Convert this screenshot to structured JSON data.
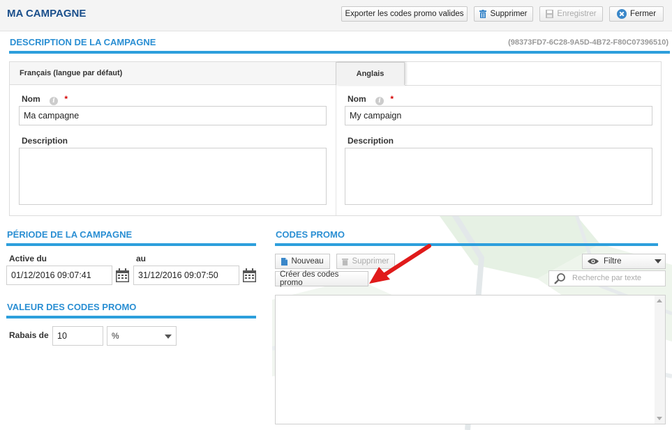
{
  "header": {
    "title": "MA CAMPAGNE",
    "buttons": {
      "export_label": "Exporter les codes promo valides",
      "delete_label": "Supprimer",
      "save_label": "Enregistrer",
      "close_label": "Fermer"
    }
  },
  "description_section": {
    "title": "DESCRIPTION DE LA CAMPAGNE",
    "campaign_id": "(98373FD7-6C28-9A5D-4B72-F80C07396510)",
    "tabs": {
      "fr_label": "Français (langue par défaut)",
      "en_label": "Anglais"
    },
    "fr": {
      "name_label": "Nom",
      "required_mark": "*",
      "name_value": "Ma campagne",
      "description_label": "Description",
      "description_value": ""
    },
    "en": {
      "name_label": "Nom",
      "required_mark": "*",
      "name_value": "My campaign",
      "description_label": "Description",
      "description_value": ""
    }
  },
  "period_section": {
    "title": "PÉRIODE DE LA CAMPAGNE",
    "start_label": "Active du",
    "start_value": "01/12/2016 09:07:41",
    "end_label": "au",
    "end_value": "31/12/2016 09:07:50"
  },
  "value_section": {
    "title": "VALEUR DES CODES PROMO",
    "discount_label": "Rabais de",
    "discount_value": "10",
    "unit_value": "%"
  },
  "codes_section": {
    "title": "CODES PROMO",
    "new_label": "Nouveau",
    "delete_label": "Supprimer",
    "create_label": "Créer des codes promo",
    "filter_label": "Filtre",
    "search_placeholder": "Recherche par texte"
  },
  "colors": {
    "accent": "#2d9fdc",
    "title": "#1a4f8b",
    "arrow": "#e01a1a"
  }
}
